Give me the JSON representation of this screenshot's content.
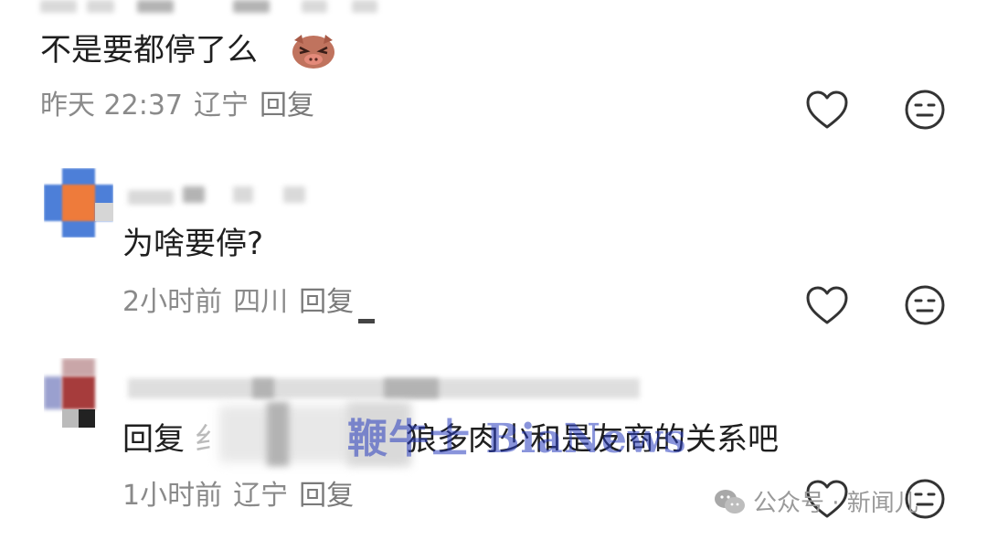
{
  "comments": [
    {
      "text": "不是要都停了么",
      "time": "昨天 22:37",
      "location": "辽宁",
      "reply_label": "回复",
      "emoji": "pig-face-emoji"
    },
    {
      "text": "为啥要停?",
      "time": "2小时前",
      "location": "四川",
      "reply_label": "回复"
    },
    {
      "reply_prefix": "回复",
      "reply_to_partial": "纟",
      "text": "狼多肉少和是友商的关系吧",
      "time": "1小时前",
      "location": "辽宁",
      "reply_label": "回复"
    }
  ],
  "watermark": {
    "site": "鞭牛士 BiaNews",
    "wechat_prefix": "公众号 · 新闻儿"
  },
  "icons": {
    "like": "heart-outline-icon",
    "reaction": "neutral-face-icon",
    "wechat": "wechat-logo-icon"
  },
  "colors": {
    "text": "#1f1f1f",
    "meta": "#8a8a8a",
    "icon_stroke": "#333333",
    "watermark": "#283cbe"
  }
}
